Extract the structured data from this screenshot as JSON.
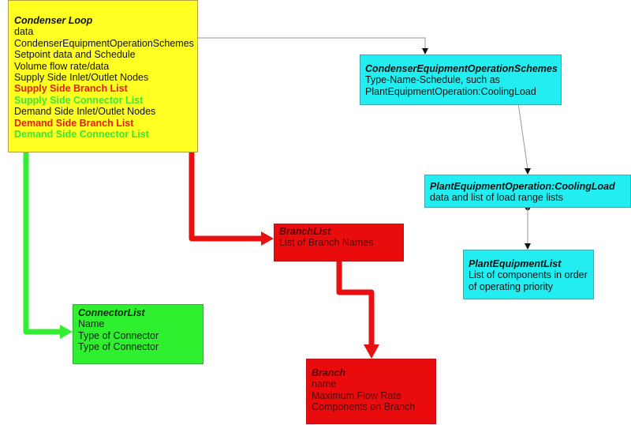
{
  "condenser_loop": {
    "title": "Condenser Loop",
    "lines": [
      {
        "text": "data",
        "style": "normal"
      },
      {
        "text": "CondenserEquipmentOperationSchemes",
        "style": "normal"
      },
      {
        "text": "Setpoint data and Schedule",
        "style": "normal"
      },
      {
        "text": "Volume flow rate/data",
        "style": "normal"
      },
      {
        "text": "Supply Side Inlet/Outlet Nodes",
        "style": "normal"
      },
      {
        "text": "Supply Side Branch List",
        "style": "red"
      },
      {
        "text": "Supply Side Connector List",
        "style": "green"
      },
      {
        "text": "Demand Side Inlet/Outlet Nodes",
        "style": "normal"
      },
      {
        "text": "Demand Side Branch List",
        "style": "red"
      },
      {
        "text": "Demand Side Connector List",
        "style": "green"
      }
    ]
  },
  "condenser_equipment_operation_schemes": {
    "title": "CondenserEquipmentOperationSchemes",
    "lines": [
      "Type-Name-Schedule, such as",
      "PlantEquipmentOperation:CoolingLoad"
    ]
  },
  "plant_equipment_operation_cooling_load": {
    "title": "PlantEquipmentOperation:CoolingLoad",
    "lines": [
      "data and list of load range lists"
    ]
  },
  "plant_equipment_list": {
    "title": "PlantEquipmentList",
    "lines": [
      "List of components in order",
      "of operating priority"
    ]
  },
  "branch_list": {
    "title": "BranchList",
    "lines": [
      "List of Branch Names"
    ]
  },
  "connector_list": {
    "title": "ConnectorList",
    "lines": [
      "Name",
      "Type of Connector",
      "Type of Connector"
    ]
  },
  "branch": {
    "title": "Branch",
    "lines": [
      "name",
      "Maximum Flow Rate",
      "Components on Branch"
    ]
  },
  "colors": {
    "loop_box": "#ffff22",
    "cyan_box": "#22eef2",
    "red_box": "#ea0c0c",
    "green_box": "#2ef02e",
    "red_arrow": "#e81010",
    "green_arrow": "#33ee33",
    "thin_connector": "#999999"
  }
}
